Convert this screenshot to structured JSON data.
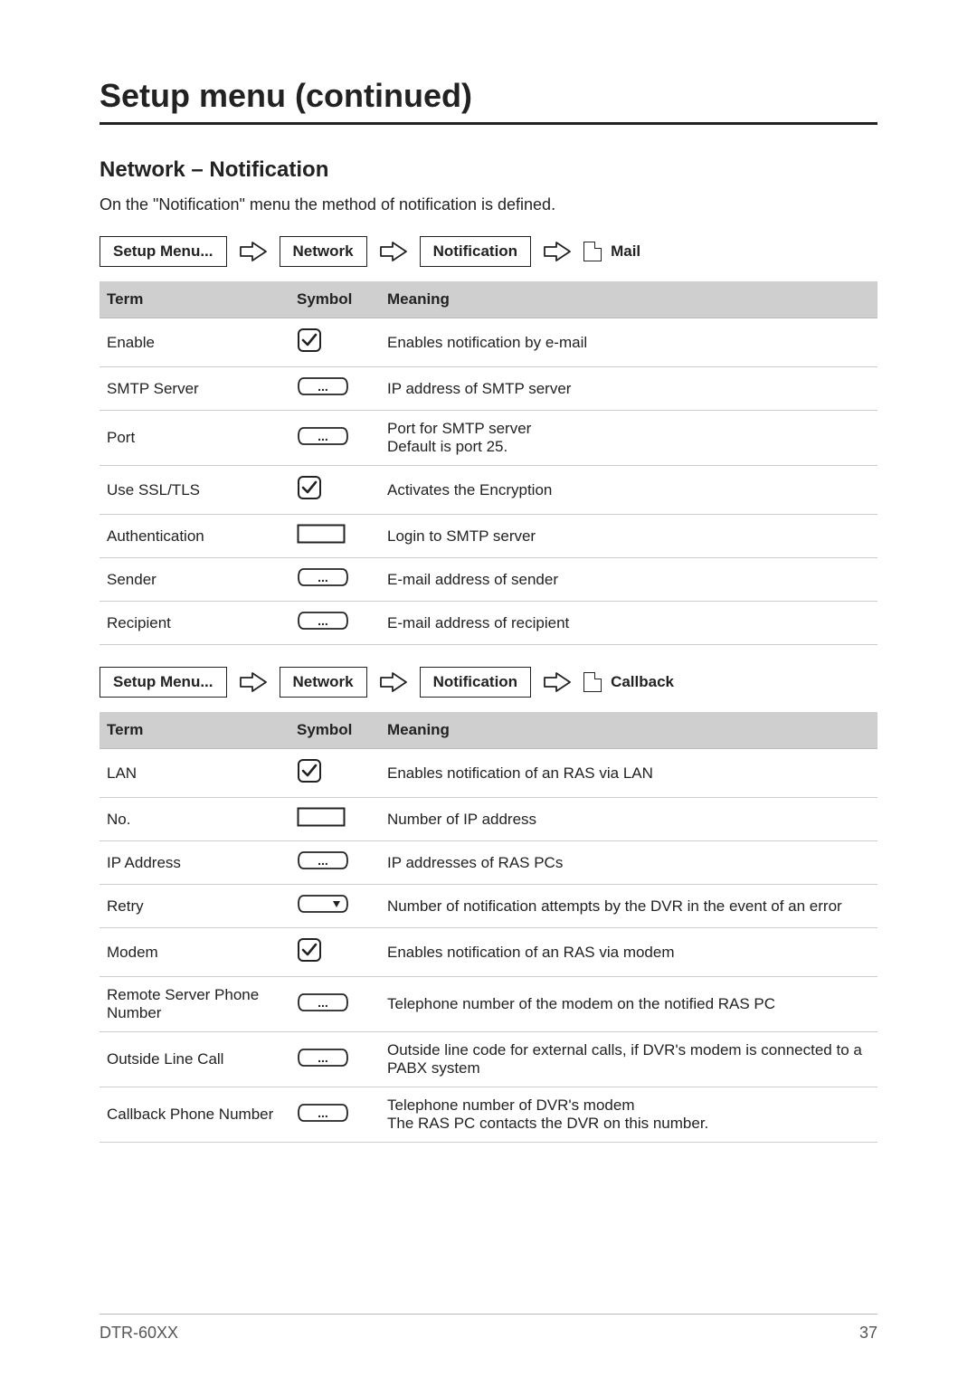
{
  "page_title": "Setup menu (continued)",
  "section_title": "Network – Notification",
  "intro_text": "On the \"Notification\" menu the method of notification is defined.",
  "footer": {
    "model": "DTR-60XX",
    "page_number": "37"
  },
  "breadcrumb1": {
    "setup": "Setup Menu...",
    "network": "Network",
    "notification": "Notification",
    "leaf": "Mail"
  },
  "breadcrumb2": {
    "setup": "Setup Menu...",
    "network": "Network",
    "notification": "Notification",
    "leaf": "Callback"
  },
  "table_headers": {
    "term": "Term",
    "symbol": "Symbol",
    "meaning": "Meaning"
  },
  "table1": [
    {
      "term": "Enable",
      "symbol": "checkbox",
      "meaning": "Enables notification by e-mail"
    },
    {
      "term": "SMTP Server",
      "symbol": "textfield",
      "meaning": "IP address of SMTP server"
    },
    {
      "term": "Port",
      "symbol": "textfield",
      "meaning": "Port for SMTP server\nDefault is port 25."
    },
    {
      "term": "Use SSL/TLS",
      "symbol": "checkbox",
      "meaning": "Activates the Encryption"
    },
    {
      "term": "Authentication",
      "symbol": "rect",
      "meaning": "Login to SMTP server"
    },
    {
      "term": "Sender",
      "symbol": "textfield",
      "meaning": "E-mail address of sender"
    },
    {
      "term": "Recipient",
      "symbol": "textfield",
      "meaning": "E-mail address of recipient"
    }
  ],
  "table2": [
    {
      "term": "LAN",
      "symbol": "checkbox",
      "meaning": "Enables notification of an RAS via LAN"
    },
    {
      "term": "No.",
      "symbol": "rect",
      "meaning": "Number of IP address"
    },
    {
      "term": "IP Address",
      "symbol": "textfield",
      "meaning": "IP addresses of RAS PCs"
    },
    {
      "term": "Retry",
      "symbol": "dropdown",
      "meaning": "Number of notification attempts by the DVR in the event of an error"
    },
    {
      "term": "Modem",
      "symbol": "checkbox",
      "meaning": "Enables notification of an RAS via modem"
    },
    {
      "term": "Remote Server Phone Number",
      "symbol": "textfield",
      "meaning": "Telephone number of the modem on the notified RAS PC"
    },
    {
      "term": "Outside Line Call",
      "symbol": "textfield",
      "meaning": "Outside line code for external calls, if DVR's modem is connected to a PABX system"
    },
    {
      "term": "Callback Phone Number",
      "symbol": "textfield",
      "meaning": "Telephone number of DVR's modem\nThe RAS PC contacts the DVR on this number."
    }
  ]
}
